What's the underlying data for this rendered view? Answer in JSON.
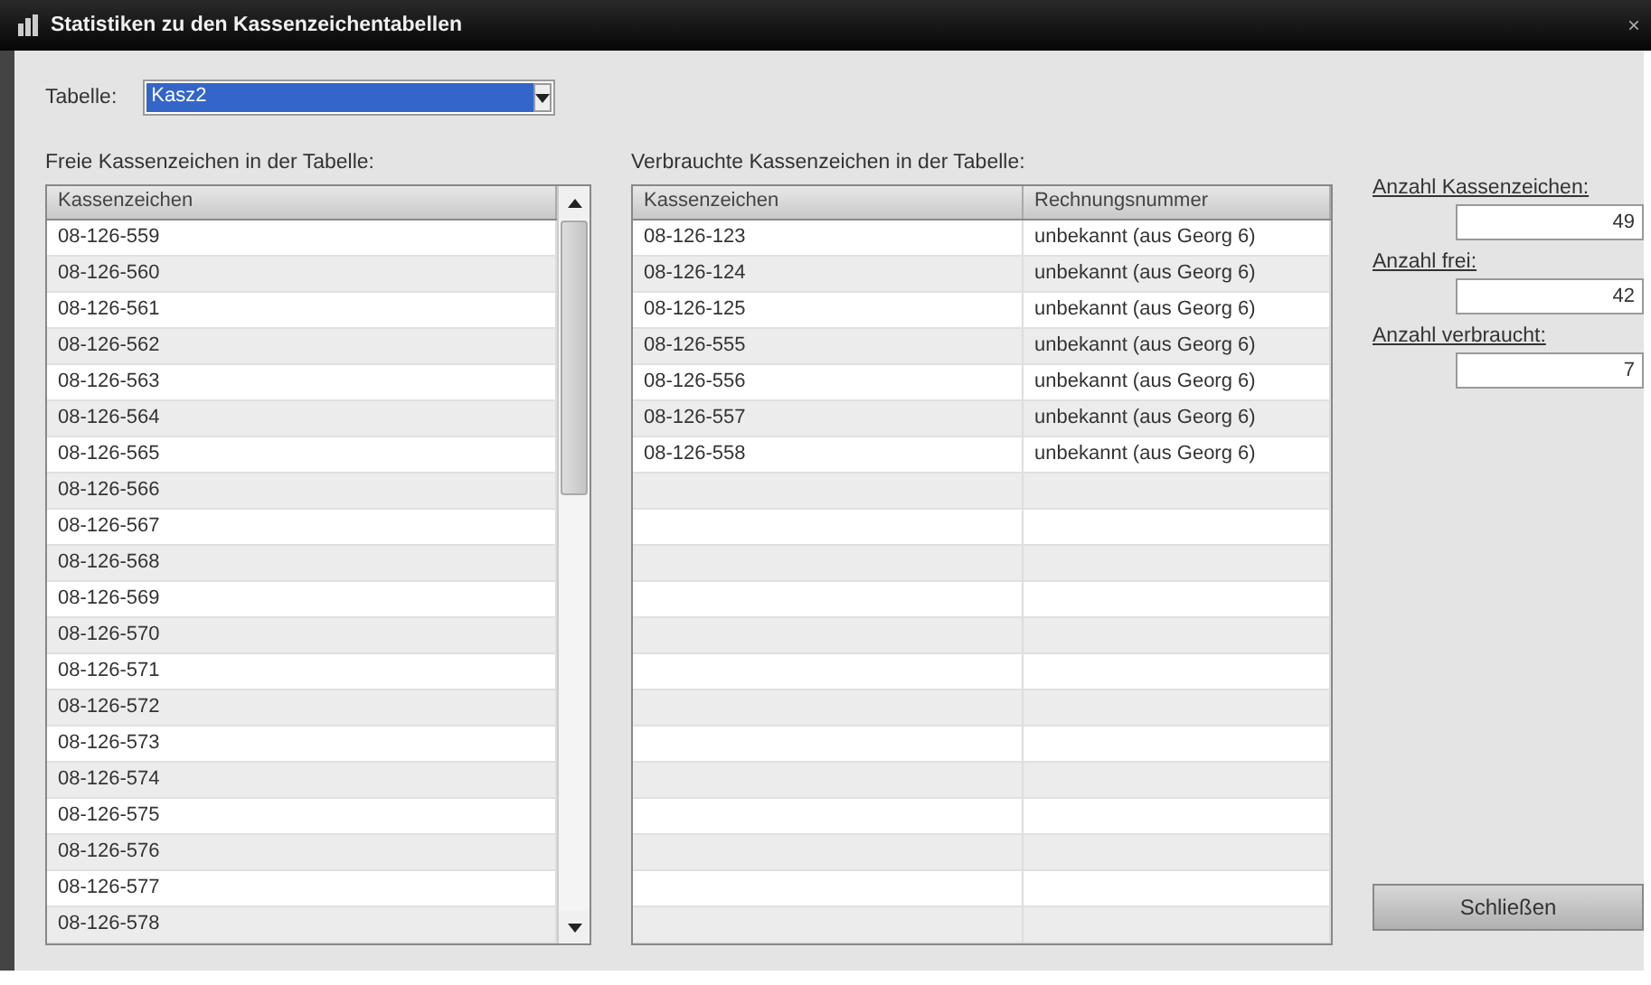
{
  "window": {
    "title": "Statistiken zu den Kassenzeichentabellen",
    "close": "×"
  },
  "table_select": {
    "label": "Tabelle:",
    "value": "Kasz2",
    "text_selected": true
  },
  "free_list": {
    "title": "Freie Kassenzeichen in der Tabelle:",
    "columns": [
      "Kassenzeichen"
    ],
    "rows": [
      [
        "08-126-559"
      ],
      [
        "08-126-560"
      ],
      [
        "08-126-561"
      ],
      [
        "08-126-562"
      ],
      [
        "08-126-563"
      ],
      [
        "08-126-564"
      ],
      [
        "08-126-565"
      ],
      [
        "08-126-566"
      ],
      [
        "08-126-567"
      ],
      [
        "08-126-568"
      ],
      [
        "08-126-569"
      ],
      [
        "08-126-570"
      ],
      [
        "08-126-571"
      ],
      [
        "08-126-572"
      ],
      [
        "08-126-573"
      ],
      [
        "08-126-574"
      ],
      [
        "08-126-575"
      ],
      [
        "08-126-576"
      ],
      [
        "08-126-577"
      ],
      [
        "08-126-578"
      ]
    ]
  },
  "used_list": {
    "title": "Verbrauchte Kassenzeichen in der Tabelle:",
    "columns": [
      "Kassenzeichen",
      "Rechnungsnummer"
    ],
    "rows": [
      [
        "08-126-123",
        "unbekannt (aus Georg 6)"
      ],
      [
        "08-126-124",
        "unbekannt (aus Georg 6)"
      ],
      [
        "08-126-125",
        "unbekannt (aus Georg 6)"
      ],
      [
        "08-126-555",
        "unbekannt (aus Georg 6)"
      ],
      [
        "08-126-556",
        "unbekannt (aus Georg 6)"
      ],
      [
        "08-126-557",
        "unbekannt (aus Georg 6)"
      ],
      [
        "08-126-558",
        "unbekannt (aus Georg 6)"
      ]
    ]
  },
  "counts": [
    {
      "label": "Anzahl Kassenzeichen:",
      "value": "49"
    },
    {
      "label": "Anzahl frei:",
      "value": "42"
    },
    {
      "label": "Anzahl verbraucht:",
      "value": "7"
    }
  ],
  "buttons": [
    "Schließen"
  ]
}
